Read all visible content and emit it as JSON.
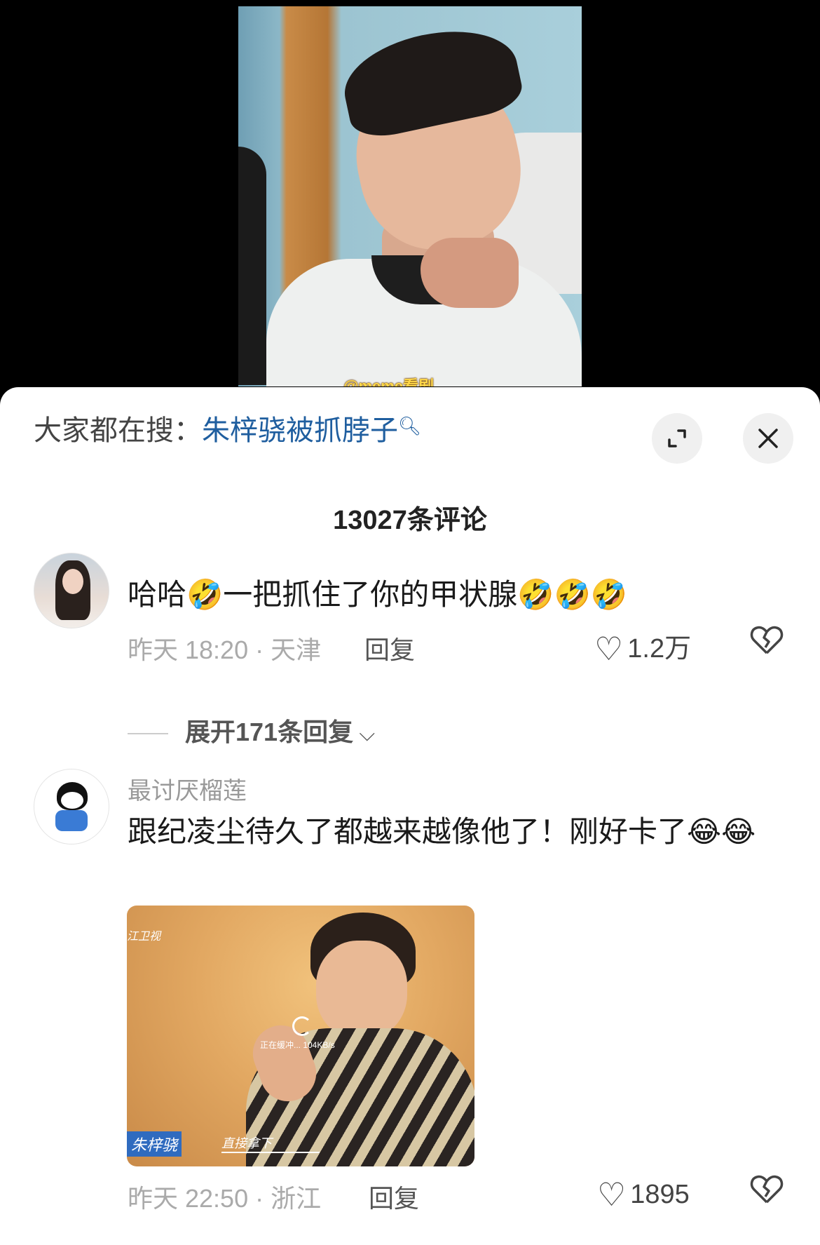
{
  "video": {
    "watermark": "@meme看剧"
  },
  "header": {
    "search_prefix": "大家都在搜：",
    "search_term": "朱梓骁被抓脖子",
    "search_icon": "search-icon",
    "expand_icon": "expand-icon",
    "close_icon": "close-icon"
  },
  "comments_title": "13027条评论",
  "comments": [
    {
      "name": "",
      "text": "哈哈🤣一把抓住了你的甲状腺🤣🤣🤣",
      "time": "昨天 18:20 · 天津",
      "reply_label": "回复",
      "likes": "1.2万",
      "expand_label": "展开171条回复"
    },
    {
      "name": "最讨厌榴莲",
      "text": "跟纪凌尘待久了都越来越像他了！刚好卡了😂😂",
      "time": "昨天 22:50 · 浙江",
      "reply_label": "回复",
      "likes": "1895",
      "image": {
        "corner_tag": "江卫视",
        "buffer_text": "正在缓冲... 104KB/s",
        "name_tag": "朱梓骁",
        "subtitle": "直接拿下"
      }
    }
  ]
}
